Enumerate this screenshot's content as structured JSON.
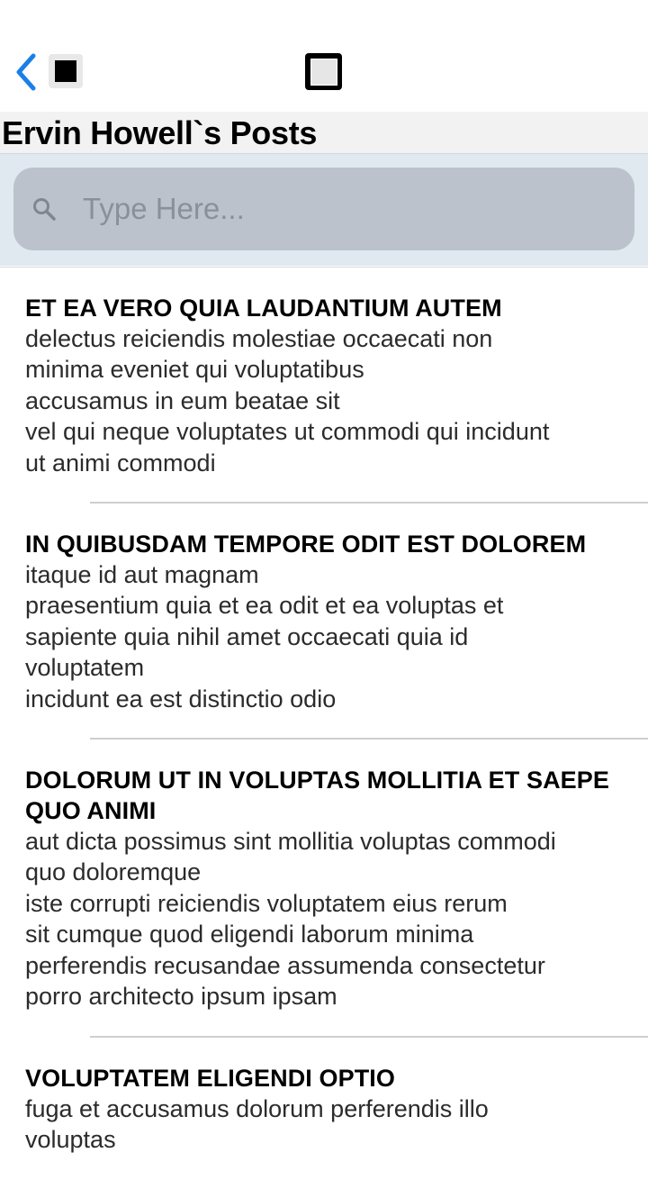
{
  "nav": {
    "back_icon": "chevron-left-icon",
    "stop_icon": "stop-square-icon",
    "title_icon": "square-icon",
    "accent": "#1a7fe8"
  },
  "header": {
    "title": "Ervin Howell`s Posts"
  },
  "search": {
    "placeholder": "Type Here...",
    "value": "",
    "icon": "search-icon"
  },
  "posts": [
    {
      "title": "ET EA VERO QUIA LAUDANTIUM AUTEM",
      "body": "delectus reiciendis molestiae occaecati non\nminima eveniet qui voluptatibus\naccusamus in eum beatae sit\nvel qui neque voluptates ut commodi qui incidunt\nut animi commodi"
    },
    {
      "title": "IN QUIBUSDAM TEMPORE ODIT EST DOLOREM",
      "body": "itaque id aut magnam\npraesentium quia et ea odit et ea voluptas et\nsapiente quia nihil amet occaecati quia id\nvoluptatem\nincidunt ea est distinctio odio"
    },
    {
      "title": "DOLORUM UT IN VOLUPTAS MOLLITIA ET SAEPE QUO ANIMI",
      "body": "aut dicta possimus sint mollitia voluptas commodi\nquo doloremque\niste corrupti reiciendis voluptatem eius rerum\nsit cumque quod eligendi laborum minima\nperferendis recusandae assumenda consectetur\nporro architecto ipsum ipsam"
    },
    {
      "title": "VOLUPTATEM ELIGENDI OPTIO",
      "body": "fuga et accusamus dolorum perferendis illo\nvoluptas"
    }
  ]
}
